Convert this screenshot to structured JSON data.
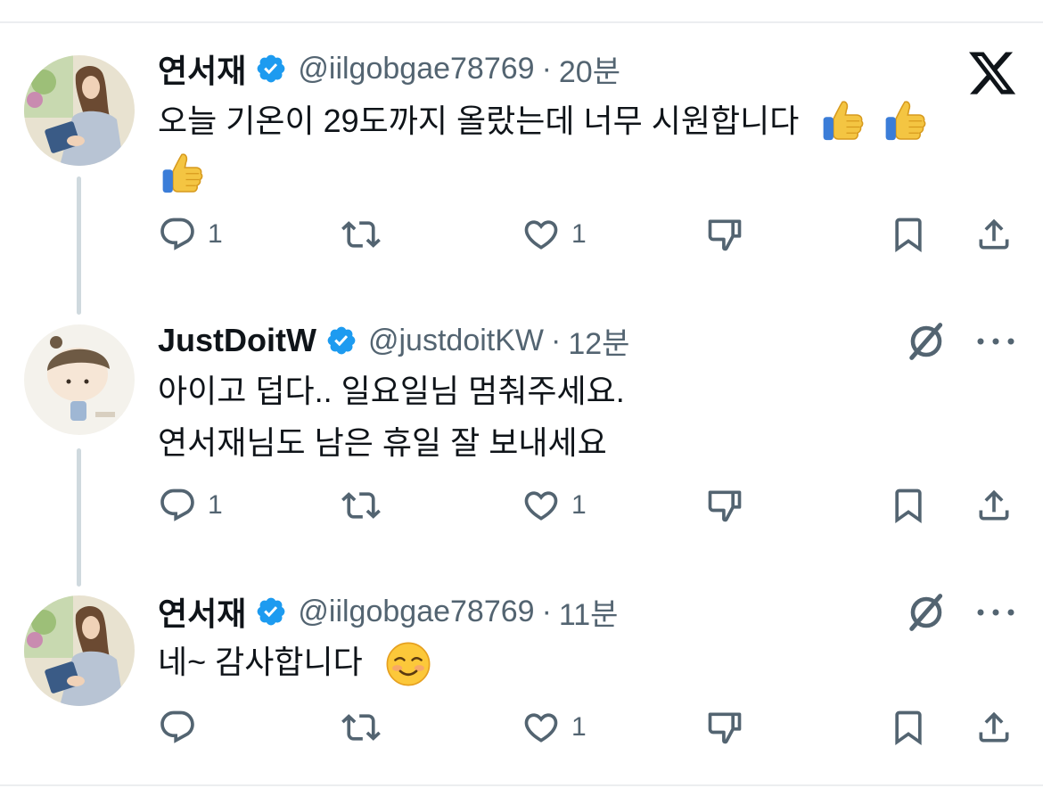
{
  "tweets": [
    {
      "author": "연서재",
      "handle": "@iilgobgae78769",
      "separator": "·",
      "time": "20분",
      "lines": [
        "오늘 기온이 29도까지 올랐는데 너무 시원합니다"
      ],
      "emoji": [
        "thumbs-up",
        "thumbs-up",
        "thumbs-up"
      ],
      "replies": "1",
      "retweets": "",
      "likes": "1",
      "avatar": "woman-reading-book"
    },
    {
      "author": "JustDoitW",
      "handle": "@justdoitKW",
      "separator": "·",
      "time": "12분",
      "lines": [
        "아이고 덥다.. 일요일님 멈춰주세요.",
        "연서재님도 남은 휴일 잘 보내세요"
      ],
      "emoji": [],
      "replies": "1",
      "retweets": "",
      "likes": "1",
      "avatar": "cartoon-boy"
    },
    {
      "author": "연서재",
      "handle": "@iilgobgae78769",
      "separator": "·",
      "time": "11분",
      "lines": [
        "네~ 감사합니다"
      ],
      "emoji": [
        "smiling-face"
      ],
      "replies": "",
      "retweets": "",
      "likes": "1",
      "avatar": "woman-reading-book"
    }
  ],
  "icons": {
    "corner": "x-logo-icon",
    "reply": "reply-icon",
    "retweet": "retweet-icon",
    "like": "heart-icon",
    "dislike": "thumbs-down-icon",
    "bookmark": "bookmark-icon",
    "share": "share-icon",
    "grok": "grok-icon",
    "more": "more-icon",
    "verified": "verified-badge-icon"
  },
  "colors": {
    "text": "#0f1419",
    "secondary": "#536471",
    "verified": "#1d9bf0",
    "thread_line": "#cfd9de"
  }
}
